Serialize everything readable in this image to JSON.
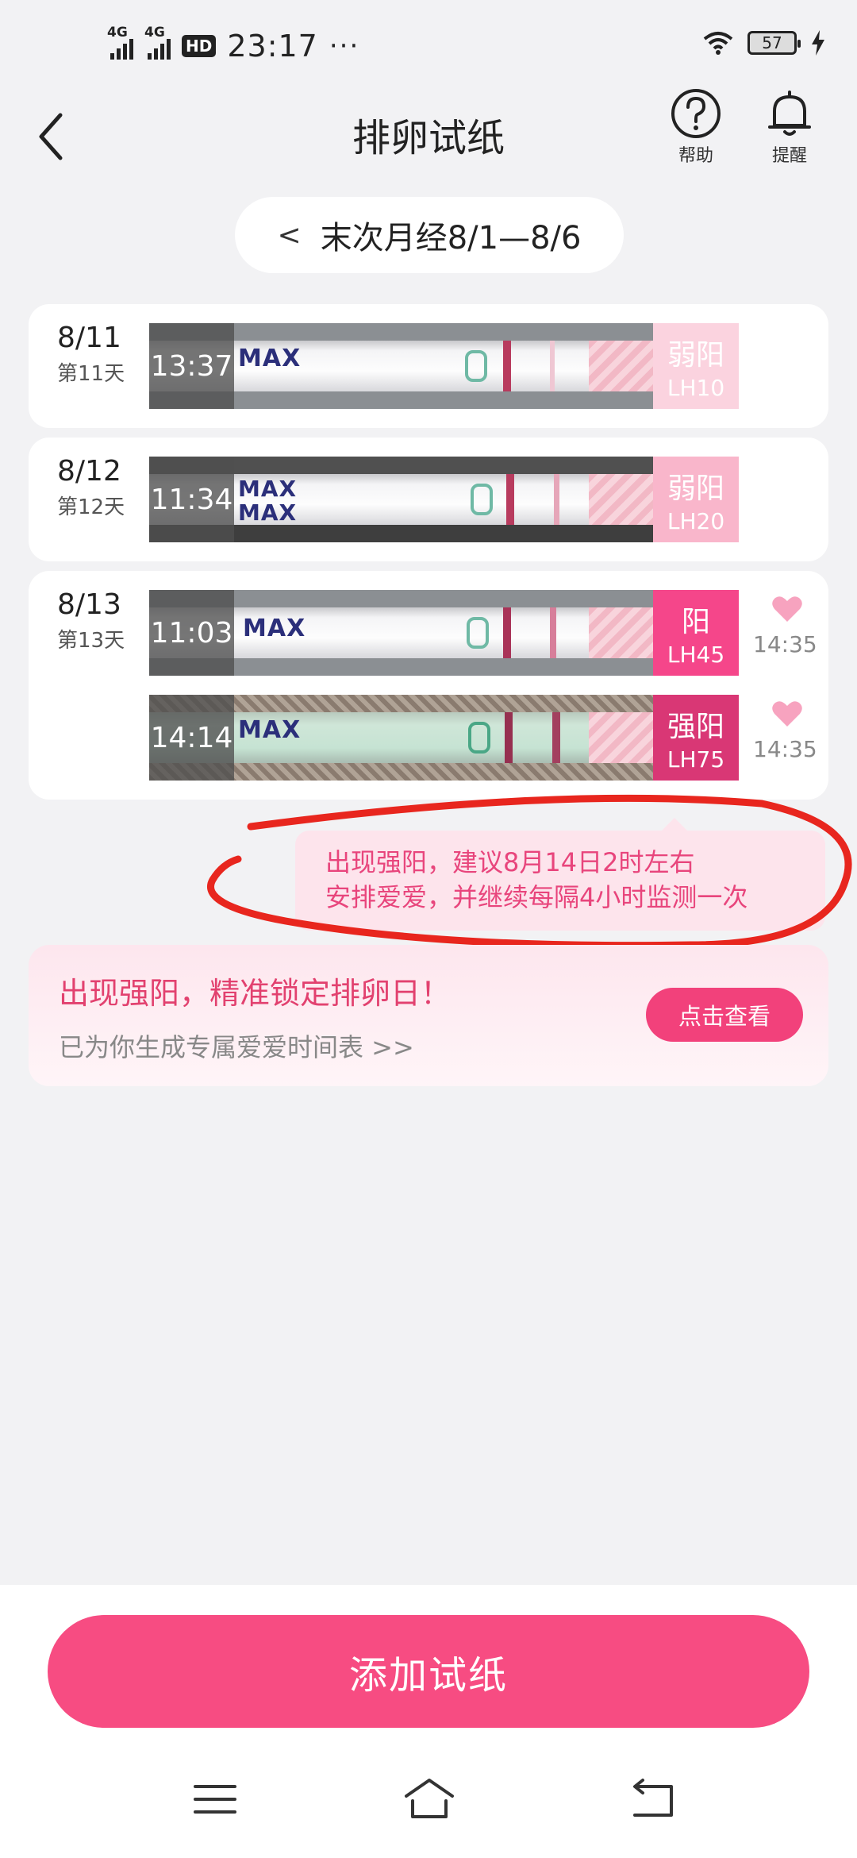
{
  "status_bar": {
    "network1": "4G",
    "network2": "4G",
    "hd_badge": "HD",
    "time": "23:17",
    "more": "···",
    "battery": "57"
  },
  "header": {
    "title": "排卵试纸",
    "help_label": "帮助",
    "remind_label": "提醒"
  },
  "period": {
    "chevron": "<",
    "label": "末次月经8/1—8/6"
  },
  "records": [
    {
      "date": "8/11",
      "day": "第11天",
      "strips": [
        {
          "time": "13:37",
          "label": "MAX",
          "result": "弱阳",
          "lh": "LH10",
          "result_color": "#fbd3df",
          "text_color": "#ffffff"
        }
      ]
    },
    {
      "date": "8/12",
      "day": "第12天",
      "strips": [
        {
          "time": "11:34",
          "label": "MAX\nMAX",
          "result": "弱阳",
          "lh": "LH20",
          "result_color": "#f9b6cb",
          "text_color": "#ffffff"
        }
      ]
    },
    {
      "date": "8/13",
      "day": "第13天",
      "strips": [
        {
          "time": "11:03",
          "label": "MAX",
          "result": "阳",
          "lh": "LH45",
          "result_color": "#f5468a",
          "text_color": "#ffffff",
          "love_time": "14:35"
        },
        {
          "time": "14:14",
          "label": "MAX",
          "result": "强阳",
          "lh": "LH75",
          "result_color": "#d93775",
          "text_color": "#ffffff",
          "love_time": "14:35"
        }
      ]
    }
  ],
  "tooltip": {
    "line1": "出现强阳，建议8月14日2时左右",
    "line2": "安排爱爱，并继续每隔4小时监测一次"
  },
  "promo": {
    "title": "出现强阳，精准锁定排卵日！",
    "subtitle": "已为你生成专属爱爱时间表 >>",
    "button": "点击查看"
  },
  "add_button": "添加试纸",
  "colors": {
    "accent": "#f74c82",
    "annotation": "#e8261e"
  }
}
